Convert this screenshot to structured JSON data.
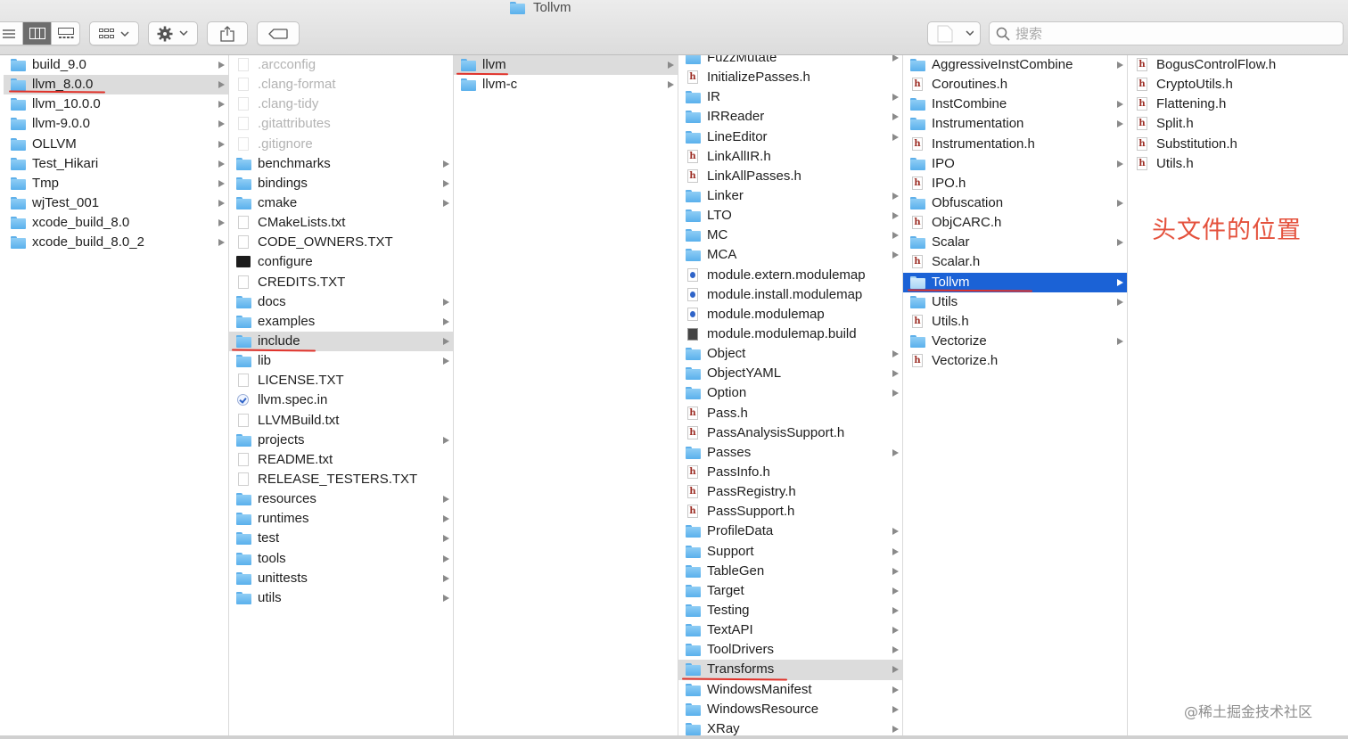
{
  "window": {
    "title": "Tollvm"
  },
  "toolbar": {
    "view_buttons": [
      "list-view",
      "column-view",
      "gallery-view"
    ],
    "group_button": "group-by",
    "action_button": "action-gear",
    "share_button": "share",
    "tag_button": "tag",
    "path_popup": "path"
  },
  "search": {
    "placeholder": "搜索",
    "value": ""
  },
  "columns": [
    {
      "id": "col1",
      "items": [
        {
          "name": "build_9.0",
          "type": "folder",
          "arrow": true
        },
        {
          "name": "llvm_8.0.0",
          "type": "folder",
          "arrow": true,
          "selected": "grey"
        },
        {
          "name": "llvm_10.0.0",
          "type": "folder",
          "arrow": true
        },
        {
          "name": "llvm-9.0.0",
          "type": "folder",
          "arrow": true
        },
        {
          "name": "OLLVM",
          "type": "folder",
          "arrow": true
        },
        {
          "name": "Test_Hikari",
          "type": "folder",
          "arrow": true
        },
        {
          "name": "Tmp",
          "type": "folder",
          "arrow": true
        },
        {
          "name": "wjTest_001",
          "type": "folder",
          "arrow": true
        },
        {
          "name": "xcode_build_8.0",
          "type": "folder",
          "arrow": true
        },
        {
          "name": "xcode_build_8.0_2",
          "type": "folder",
          "arrow": true
        }
      ]
    },
    {
      "id": "col2",
      "items": [
        {
          "name": ".arcconfig",
          "type": "doc",
          "dim": true
        },
        {
          "name": ".clang-format",
          "type": "doc",
          "dim": true
        },
        {
          "name": ".clang-tidy",
          "type": "doc",
          "dim": true
        },
        {
          "name": ".gitattributes",
          "type": "doc",
          "dim": true
        },
        {
          "name": ".gitignore",
          "type": "doc",
          "dim": true
        },
        {
          "name": "benchmarks",
          "type": "folder",
          "arrow": true
        },
        {
          "name": "bindings",
          "type": "folder",
          "arrow": true
        },
        {
          "name": "cmake",
          "type": "folder",
          "arrow": true
        },
        {
          "name": "CMakeLists.txt",
          "type": "doc"
        },
        {
          "name": "CODE_OWNERS.TXT",
          "type": "doc"
        },
        {
          "name": "configure",
          "type": "term"
        },
        {
          "name": "CREDITS.TXT",
          "type": "doc"
        },
        {
          "name": "docs",
          "type": "folder",
          "arrow": true
        },
        {
          "name": "examples",
          "type": "folder",
          "arrow": true
        },
        {
          "name": "include",
          "type": "folder",
          "arrow": true,
          "selected": "grey"
        },
        {
          "name": "lib",
          "type": "folder",
          "arrow": true
        },
        {
          "name": "LICENSE.TXT",
          "type": "doc"
        },
        {
          "name": "llvm.spec.in",
          "type": "spec"
        },
        {
          "name": "LLVMBuild.txt",
          "type": "doc"
        },
        {
          "name": "projects",
          "type": "folder",
          "arrow": true
        },
        {
          "name": "README.txt",
          "type": "doc"
        },
        {
          "name": "RELEASE_TESTERS.TXT",
          "type": "doc"
        },
        {
          "name": "resources",
          "type": "folder",
          "arrow": true
        },
        {
          "name": "runtimes",
          "type": "folder",
          "arrow": true
        },
        {
          "name": "test",
          "type": "folder",
          "arrow": true
        },
        {
          "name": "tools",
          "type": "folder",
          "arrow": true
        },
        {
          "name": "unittests",
          "type": "folder",
          "arrow": true
        },
        {
          "name": "utils",
          "type": "folder",
          "arrow": true
        }
      ]
    },
    {
      "id": "col3",
      "items": [
        {
          "name": "llvm",
          "type": "folder",
          "arrow": true,
          "selected": "grey"
        },
        {
          "name": "llvm-c",
          "type": "folder",
          "arrow": true
        }
      ]
    },
    {
      "id": "col4",
      "items": [
        {
          "name": "FuzzMutate",
          "type": "folder",
          "arrow": true
        },
        {
          "name": "InitializePasses.h",
          "type": "h"
        },
        {
          "name": "IR",
          "type": "folder",
          "arrow": true
        },
        {
          "name": "IRReader",
          "type": "folder",
          "arrow": true
        },
        {
          "name": "LineEditor",
          "type": "folder",
          "arrow": true
        },
        {
          "name": "LinkAllIR.h",
          "type": "h"
        },
        {
          "name": "LinkAllPasses.h",
          "type": "h"
        },
        {
          "name": "Linker",
          "type": "folder",
          "arrow": true
        },
        {
          "name": "LTO",
          "type": "folder",
          "arrow": true
        },
        {
          "name": "MC",
          "type": "folder",
          "arrow": true
        },
        {
          "name": "MCA",
          "type": "folder",
          "arrow": true
        },
        {
          "name": "module.extern.modulemap",
          "type": "modmap"
        },
        {
          "name": "module.install.modulemap",
          "type": "modmap"
        },
        {
          "name": "module.modulemap",
          "type": "modmap"
        },
        {
          "name": "module.modulemap.build",
          "type": "bin"
        },
        {
          "name": "Object",
          "type": "folder",
          "arrow": true
        },
        {
          "name": "ObjectYAML",
          "type": "folder",
          "arrow": true
        },
        {
          "name": "Option",
          "type": "folder",
          "arrow": true
        },
        {
          "name": "Pass.h",
          "type": "h"
        },
        {
          "name": "PassAnalysisSupport.h",
          "type": "h"
        },
        {
          "name": "Passes",
          "type": "folder",
          "arrow": true
        },
        {
          "name": "PassInfo.h",
          "type": "h"
        },
        {
          "name": "PassRegistry.h",
          "type": "h"
        },
        {
          "name": "PassSupport.h",
          "type": "h"
        },
        {
          "name": "ProfileData",
          "type": "folder",
          "arrow": true
        },
        {
          "name": "Support",
          "type": "folder",
          "arrow": true
        },
        {
          "name": "TableGen",
          "type": "folder",
          "arrow": true
        },
        {
          "name": "Target",
          "type": "folder",
          "arrow": true
        },
        {
          "name": "Testing",
          "type": "folder",
          "arrow": true
        },
        {
          "name": "TextAPI",
          "type": "folder",
          "arrow": true
        },
        {
          "name": "ToolDrivers",
          "type": "folder",
          "arrow": true
        },
        {
          "name": "Transforms",
          "type": "folder",
          "arrow": true,
          "selected": "grey"
        },
        {
          "name": "WindowsManifest",
          "type": "folder",
          "arrow": true
        },
        {
          "name": "WindowsResource",
          "type": "folder",
          "arrow": true
        },
        {
          "name": "XRay",
          "type": "folder",
          "arrow": true
        }
      ]
    },
    {
      "id": "col5",
      "items": [
        {
          "name": "AggressiveInstCombine",
          "type": "folder",
          "arrow": true
        },
        {
          "name": "Coroutines.h",
          "type": "h"
        },
        {
          "name": "InstCombine",
          "type": "folder",
          "arrow": true
        },
        {
          "name": "Instrumentation",
          "type": "folder",
          "arrow": true
        },
        {
          "name": "Instrumentation.h",
          "type": "h"
        },
        {
          "name": "IPO",
          "type": "folder",
          "arrow": true
        },
        {
          "name": "IPO.h",
          "type": "h"
        },
        {
          "name": "Obfuscation",
          "type": "folder",
          "arrow": true
        },
        {
          "name": "ObjCARC.h",
          "type": "h"
        },
        {
          "name": "Scalar",
          "type": "folder",
          "arrow": true
        },
        {
          "name": "Scalar.h",
          "type": "h"
        },
        {
          "name": "Tollvm",
          "type": "folder",
          "arrow": true,
          "selected": "blue"
        },
        {
          "name": "Utils",
          "type": "folder",
          "arrow": true
        },
        {
          "name": "Utils.h",
          "type": "h"
        },
        {
          "name": "Vectorize",
          "type": "folder",
          "arrow": true
        },
        {
          "name": "Vectorize.h",
          "type": "h"
        }
      ]
    },
    {
      "id": "col6",
      "items": [
        {
          "name": "BogusControlFlow.h",
          "type": "h"
        },
        {
          "name": "CryptoUtils.h",
          "type": "h"
        },
        {
          "name": "Flattening.h",
          "type": "h"
        },
        {
          "name": "Split.h",
          "type": "h"
        },
        {
          "name": "Substitution.h",
          "type": "h"
        },
        {
          "name": "Utils.h",
          "type": "h"
        }
      ]
    }
  ],
  "annotation": {
    "text": "头文件的位置",
    "color": "#e4513c"
  },
  "watermark": {
    "text": "@稀土掘金技术社区"
  },
  "colors": {
    "selection_blue": "#1b62d6",
    "selection_grey": "#dcdcdc",
    "underline_red": "#e0322a",
    "folder_blue": "#5ab0ec"
  }
}
